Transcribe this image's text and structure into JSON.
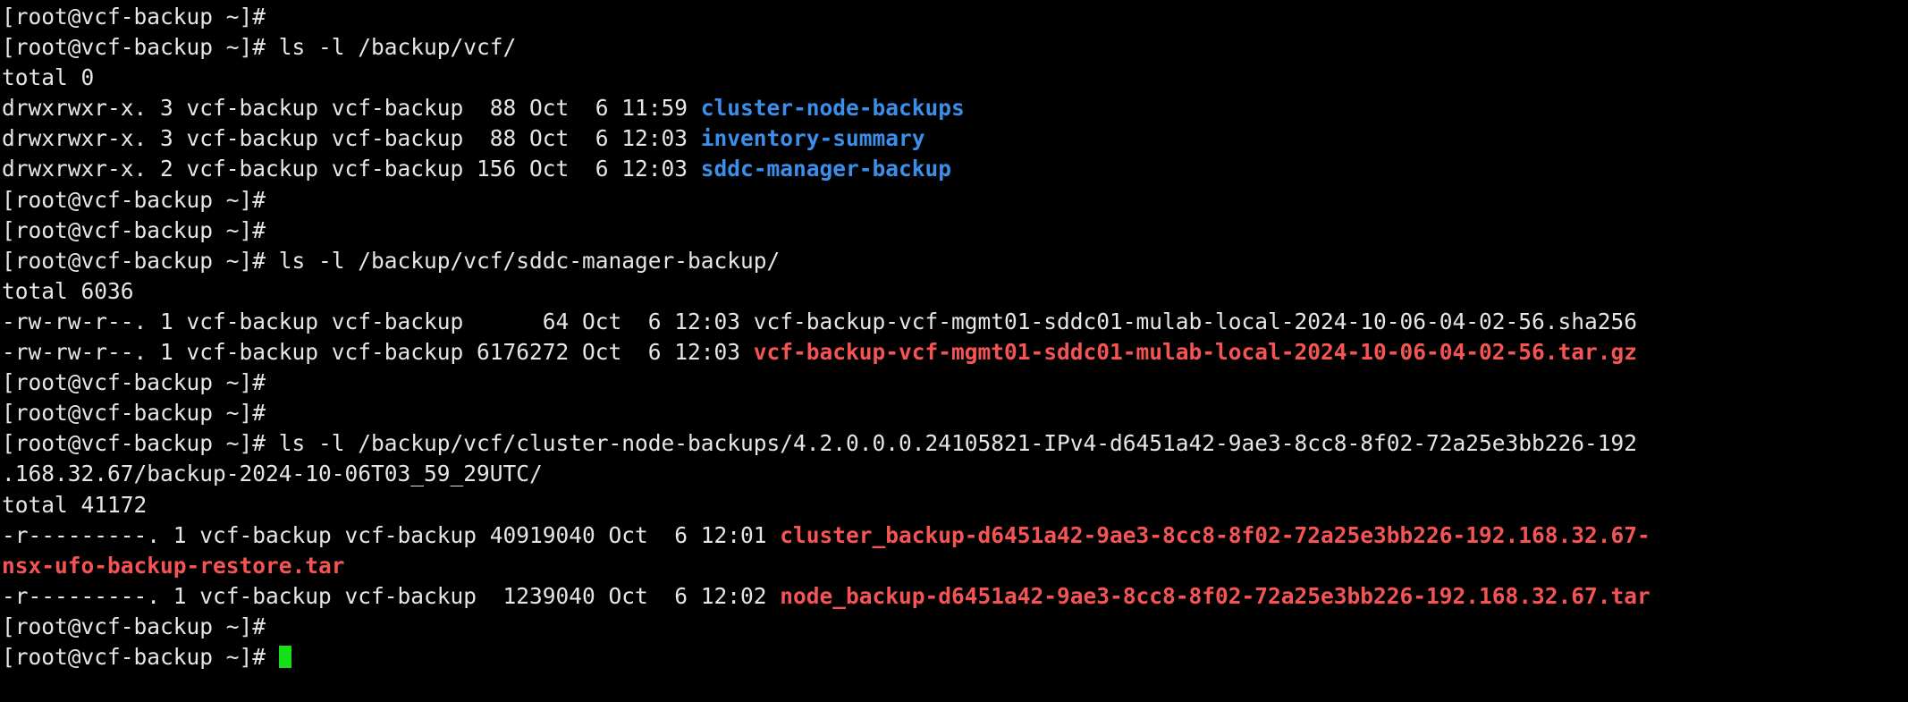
{
  "terminal": {
    "prompt": "[root@vcf-backup ~]# ",
    "colors": {
      "background": "#000000",
      "foreground": "#e6e6e6",
      "directory": "#3b8eea",
      "archive": "#f55454",
      "cursor": "#18e018"
    },
    "lines": [
      {
        "id": "l01",
        "type": "prompt",
        "prompt": "[root@vcf-backup ~]# ",
        "command": ""
      },
      {
        "id": "l02",
        "type": "prompt",
        "prompt": "[root@vcf-backup ~]# ",
        "command": "ls -l /backup/vcf/"
      },
      {
        "id": "l03",
        "type": "output",
        "text": "total 0"
      },
      {
        "id": "l04",
        "type": "listing",
        "meta": "drwxrwxr-x. 3 vcf-backup vcf-backup  88 Oct  6 11:59 ",
        "name": "cluster-node-backups",
        "nameclass": "dir"
      },
      {
        "id": "l05",
        "type": "listing",
        "meta": "drwxrwxr-x. 3 vcf-backup vcf-backup  88 Oct  6 12:03 ",
        "name": "inventory-summary",
        "nameclass": "dir"
      },
      {
        "id": "l06",
        "type": "listing",
        "meta": "drwxrwxr-x. 2 vcf-backup vcf-backup 156 Oct  6 12:03 ",
        "name": "sddc-manager-backup",
        "nameclass": "dir"
      },
      {
        "id": "l07",
        "type": "prompt",
        "prompt": "[root@vcf-backup ~]# ",
        "command": ""
      },
      {
        "id": "l08",
        "type": "prompt",
        "prompt": "[root@vcf-backup ~]# ",
        "command": ""
      },
      {
        "id": "l09",
        "type": "prompt",
        "prompt": "[root@vcf-backup ~]# ",
        "command": "ls -l /backup/vcf/sddc-manager-backup/"
      },
      {
        "id": "l10",
        "type": "output",
        "text": "total 6036"
      },
      {
        "id": "l11",
        "type": "listing",
        "meta": "-rw-rw-r--. 1 vcf-backup vcf-backup      64 Oct  6 12:03 ",
        "name": "vcf-backup-vcf-mgmt01-sddc01-mulab-local-2024-10-06-04-02-56.sha256",
        "nameclass": "w"
      },
      {
        "id": "l12",
        "type": "listing",
        "meta": "-rw-rw-r--. 1 vcf-backup vcf-backup 6176272 Oct  6 12:03 ",
        "name": "vcf-backup-vcf-mgmt01-sddc01-mulab-local-2024-10-06-04-02-56.tar.gz",
        "nameclass": "arc"
      },
      {
        "id": "l13",
        "type": "prompt",
        "prompt": "[root@vcf-backup ~]# ",
        "command": ""
      },
      {
        "id": "l14",
        "type": "prompt",
        "prompt": "[root@vcf-backup ~]# ",
        "command": ""
      },
      {
        "id": "l15",
        "type": "prompt",
        "prompt": "[root@vcf-backup ~]# ",
        "command": "ls -l /backup/vcf/cluster-node-backups/4.2.0.0.0.24105821-IPv4-d6451a42-9ae3-8cc8-8f02-72a25e3bb226-192"
      },
      {
        "id": "l16",
        "type": "output",
        "text": ".168.32.67/backup-2024-10-06T03_59_29UTC/"
      },
      {
        "id": "l17",
        "type": "output",
        "text": "total 41172"
      },
      {
        "id": "l18",
        "type": "listing",
        "meta": "-r---------. 1 vcf-backup vcf-backup 40919040 Oct  6 12:01 ",
        "name": "cluster_backup-d6451a42-9ae3-8cc8-8f02-72a25e3bb226-192.168.32.67-",
        "nameclass": "arc"
      },
      {
        "id": "l19",
        "type": "wrap",
        "name": "nsx-ufo-backup-restore.tar",
        "nameclass": "arc"
      },
      {
        "id": "l20",
        "type": "listing",
        "meta": "-r---------. 1 vcf-backup vcf-backup  1239040 Oct  6 12:02 ",
        "name": "node_backup-d6451a42-9ae3-8cc8-8f02-72a25e3bb226-192.168.32.67.tar",
        "nameclass": "arc"
      },
      {
        "id": "l21",
        "type": "prompt",
        "prompt": "[root@vcf-backup ~]# ",
        "command": ""
      },
      {
        "id": "l22",
        "type": "cursor",
        "prompt": "[root@vcf-backup ~]# ",
        "command": ""
      }
    ]
  }
}
